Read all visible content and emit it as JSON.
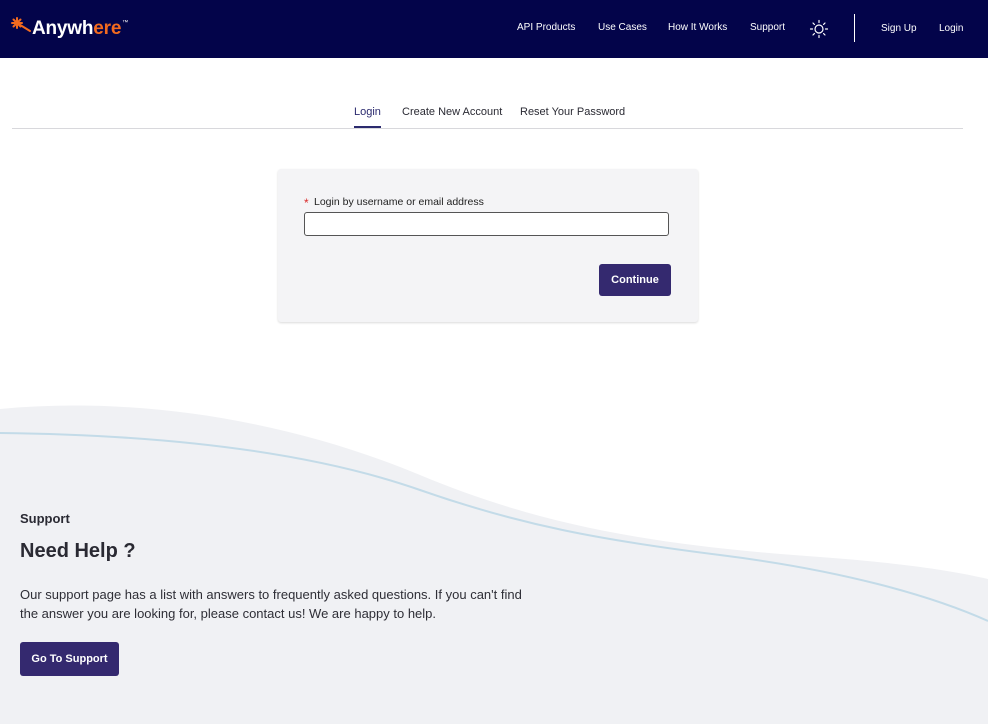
{
  "header": {
    "logo": {
      "text_main": "Anywh",
      "text_accent": "ere",
      "trademark": "™",
      "accent_color": "#f26a1f"
    },
    "nav": [
      {
        "label": "API Products"
      },
      {
        "label": "Use Cases"
      },
      {
        "label": "How It Works"
      },
      {
        "label": "Support"
      }
    ],
    "theme_icon": "sun-icon",
    "auth": {
      "signup_label": "Sign Up",
      "login_label": "Login"
    },
    "background_color": "#03044a"
  },
  "tabs": {
    "items": [
      {
        "label": "Login",
        "active": true
      },
      {
        "label": "Create New Account",
        "active": false
      },
      {
        "label": "Reset Your Password",
        "active": false
      }
    ]
  },
  "login_form": {
    "required_marker": "*",
    "field_label": "Login by username or email address",
    "field_value": "",
    "continue_label": "Continue"
  },
  "support": {
    "eyebrow": "Support",
    "title": "Need Help ?",
    "body": "Our support page has a list with answers to frequently asked questions. If you can't find the answer you are looking for, please contact us! We are happy to help.",
    "button_label": "Go To Support",
    "button_color": "#34296f"
  }
}
